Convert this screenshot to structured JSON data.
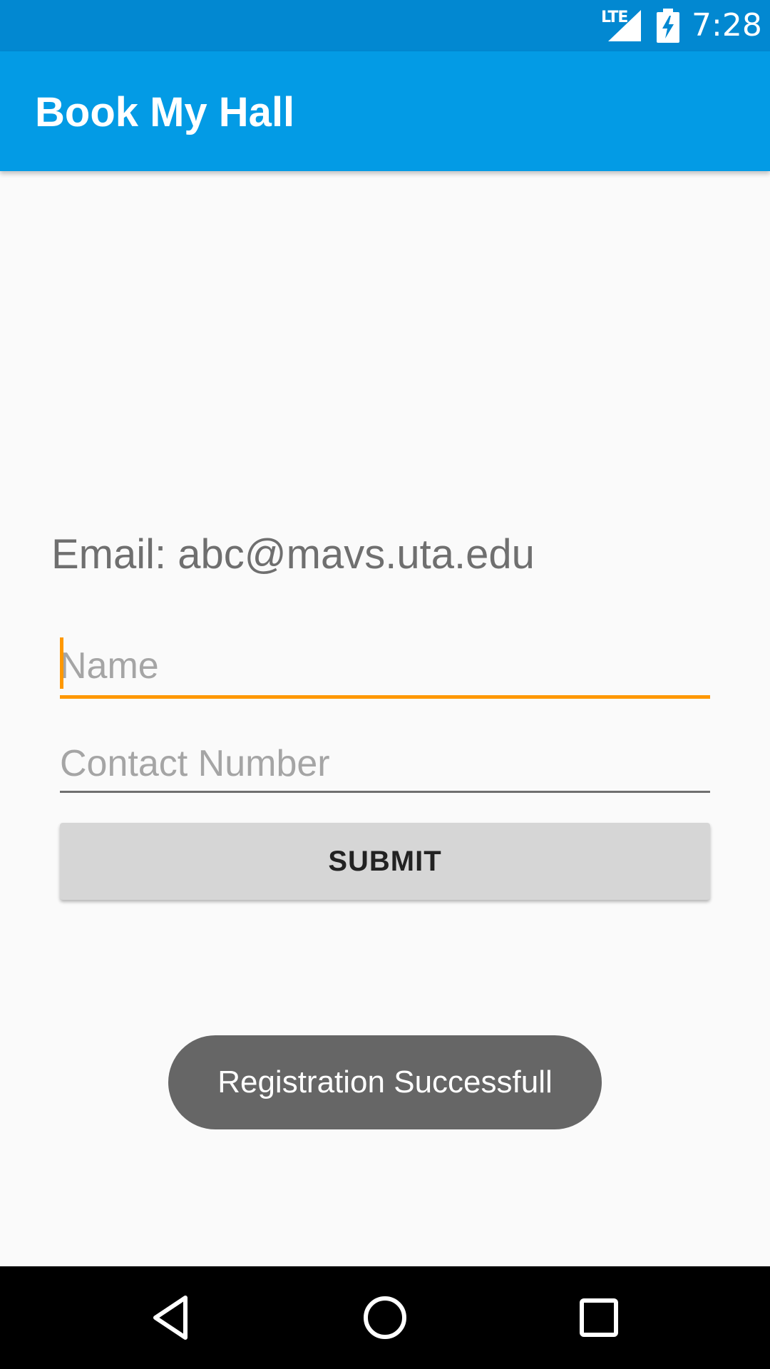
{
  "status_bar": {
    "network": "LTE",
    "time": "7:28",
    "icons": [
      "signal-icon",
      "battery-charging-icon"
    ]
  },
  "app_bar": {
    "title": "Book My Hall"
  },
  "form": {
    "email_text": "Email: abc@mavs.uta.edu",
    "name_placeholder": "Name",
    "name_value": "",
    "contact_placeholder": "Contact Number",
    "contact_value": "",
    "submit_label": "SUBMIT"
  },
  "toast": {
    "message": "Registration Successfull"
  },
  "nav_bar": {
    "icons": [
      "back-icon",
      "home-icon",
      "recents-icon"
    ]
  },
  "colors": {
    "status_bar": "#0288d1",
    "app_bar": "#039be5",
    "accent": "#ff9800",
    "background": "#fafafa",
    "button": "#d6d6d6",
    "toast": "#666666"
  }
}
